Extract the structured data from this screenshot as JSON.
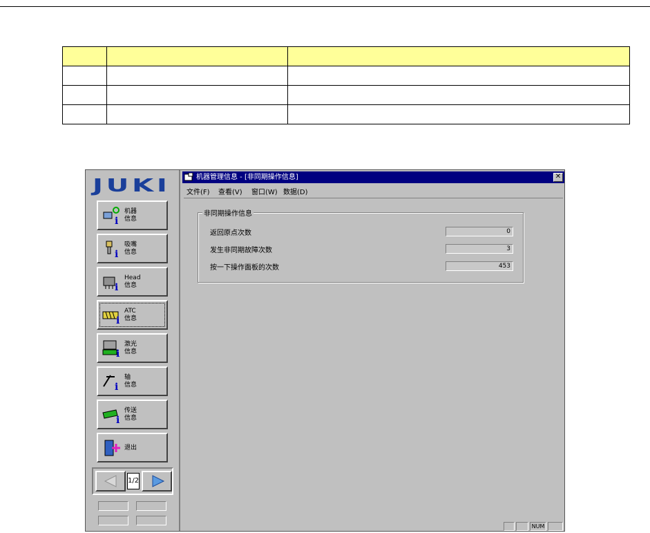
{
  "table": {
    "rows": 4,
    "cols": 3
  },
  "app": {
    "logo": "JUKI",
    "nav": [
      {
        "label": "机器\n信息",
        "icon": "machine-info-icon"
      },
      {
        "label": "吸嘴\n信息",
        "icon": "nozzle-info-icon"
      },
      {
        "label": "Head\n信息",
        "icon": "head-info-icon"
      },
      {
        "label": "ATC\n信息",
        "icon": "atc-info-icon",
        "focused": true
      },
      {
        "label": "激光\n信息",
        "icon": "laser-info-icon"
      },
      {
        "label": "轴\n信息",
        "icon": "axis-info-icon"
      },
      {
        "label": "传送\n信息",
        "icon": "conveyor-info-icon"
      },
      {
        "label": "退出",
        "icon": "exit-door-icon"
      }
    ],
    "pager": {
      "page": "1/2"
    }
  },
  "window": {
    "title": "机器管理信息 - [非同期操作信息]",
    "close": "✕",
    "menu": [
      "文件(F)",
      "查看(V)",
      "窗口(W)",
      "数据(D)"
    ],
    "group": {
      "title": "非同期操作信息",
      "rows": [
        {
          "label": "返回原点次数",
          "value": "0"
        },
        {
          "label": "发生非同期故障次数",
          "value": "3"
        },
        {
          "label": "按一下操作面板的次数",
          "value": "453"
        }
      ]
    },
    "status": {
      "num": "NUM"
    }
  },
  "colors": {
    "title_bar": "#000080",
    "table_header": "#ffff99",
    "logo": "#1a3f9a"
  }
}
